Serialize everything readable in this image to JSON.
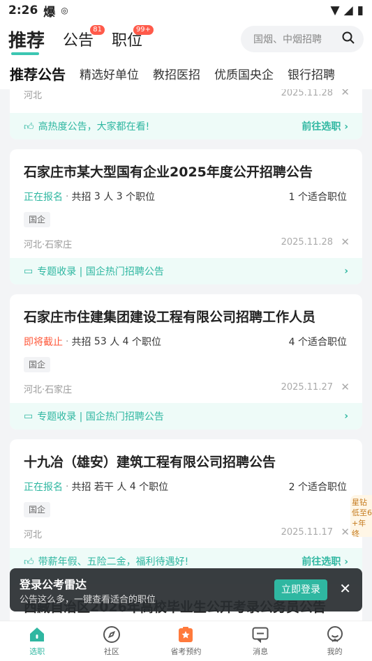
{
  "status": {
    "time": "2:26",
    "icon1": "爆"
  },
  "top_tabs": [
    {
      "label": "推荐"
    },
    {
      "label": "公告",
      "badge": "81"
    },
    {
      "label": "职位",
      "badge": "99+"
    }
  ],
  "search": {
    "placeholder": "国烟、中烟招聘"
  },
  "sub_tabs": [
    "推荐公告",
    "精选好单位",
    "教招医招",
    "优质国央企",
    "银行招聘"
  ],
  "partial_card": {
    "location": "河北",
    "date": "2025.11.28",
    "strip_text": "高热度公告，大家都在看!",
    "strip_cta": "前往选职"
  },
  "cards": [
    {
      "title": "石家庄市某大型国有企业2025年度公开招聘公告",
      "status": "正在报名",
      "recruit_prefix": "共招",
      "recruit_count": "3",
      "recruit_unit": "人",
      "positions": "3",
      "positions_label": "个职位",
      "fit_count": "1",
      "fit_label": "个适合职位",
      "tag": "国企",
      "location": "河北·石家庄",
      "date": "2025.11.28",
      "strip_text": "专题收录 | 国企热门招聘公告"
    },
    {
      "title": "石家庄市住建集团建设工程有限公司招聘工作人员",
      "status": "即将截止",
      "recruit_prefix": "共招",
      "recruit_count": "53",
      "recruit_unit": "人",
      "positions": "4",
      "positions_label": "个职位",
      "fit_count": "4",
      "fit_label": "个适合职位",
      "tag": "国企",
      "location": "河北·石家庄",
      "date": "2025.11.27",
      "strip_text": "专题收录 | 国企热门招聘公告"
    },
    {
      "title": "十九冶（雄安）建筑工程有限公司招聘公告",
      "status": "正在报名",
      "recruit_prefix": "共招",
      "recruit_count": "若干",
      "recruit_unit": "人",
      "positions": "4",
      "positions_label": "个职位",
      "fit_count": "2",
      "fit_label": "个适合职位",
      "tag": "国企",
      "location": "河北",
      "date": "2025.11.17",
      "strip_text": "带薪年假、五险二金，福利待遇好!",
      "strip_cta": "前往选职"
    },
    {
      "title": "西藏自治区2026年高校毕业生公开考录公务员公告"
    }
  ],
  "login_bar": {
    "title": "登录公考雷达",
    "subtitle": "公告这么多，一键查看适合的职位",
    "button": "立即登录"
  },
  "side_ad": {
    "line1": "星钻",
    "line2": "低至6",
    "line3": "+年终"
  },
  "bottom_tabs": [
    "选职",
    "社区",
    "省考预约",
    "消息",
    "我的"
  ],
  "colors": {
    "accent": "#2fb7a1",
    "urgent": "#ff5a3c",
    "badge": "#ff5a4a"
  }
}
